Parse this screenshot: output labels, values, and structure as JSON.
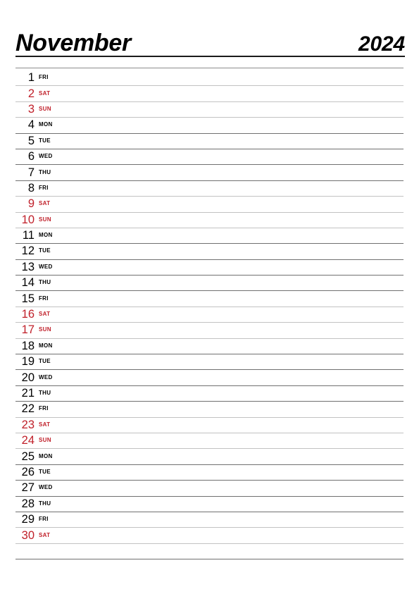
{
  "header": {
    "month": "November",
    "year": "2024"
  },
  "colors": {
    "weekend": "#c0202a",
    "weekday": "#000000",
    "rule_strong": "#1a1a1a",
    "rule_normal": "#707070",
    "rule_light": "#c2c2c2",
    "background": "#ffffff"
  },
  "days": [
    {
      "num": "1",
      "abbr": "FRI",
      "weekend": false
    },
    {
      "num": "2",
      "abbr": "SAT",
      "weekend": true
    },
    {
      "num": "3",
      "abbr": "SUN",
      "weekend": true
    },
    {
      "num": "4",
      "abbr": "MON",
      "weekend": false
    },
    {
      "num": "5",
      "abbr": "TUE",
      "weekend": false
    },
    {
      "num": "6",
      "abbr": "WED",
      "weekend": false
    },
    {
      "num": "7",
      "abbr": "THU",
      "weekend": false
    },
    {
      "num": "8",
      "abbr": "FRI",
      "weekend": false
    },
    {
      "num": "9",
      "abbr": "SAT",
      "weekend": true
    },
    {
      "num": "10",
      "abbr": "SUN",
      "weekend": true
    },
    {
      "num": "11",
      "abbr": "MON",
      "weekend": false
    },
    {
      "num": "12",
      "abbr": "TUE",
      "weekend": false
    },
    {
      "num": "13",
      "abbr": "WED",
      "weekend": false
    },
    {
      "num": "14",
      "abbr": "THU",
      "weekend": false
    },
    {
      "num": "15",
      "abbr": "FRI",
      "weekend": false
    },
    {
      "num": "16",
      "abbr": "SAT",
      "weekend": true
    },
    {
      "num": "17",
      "abbr": "SUN",
      "weekend": true
    },
    {
      "num": "18",
      "abbr": "MON",
      "weekend": false
    },
    {
      "num": "19",
      "abbr": "TUE",
      "weekend": false
    },
    {
      "num": "20",
      "abbr": "WED",
      "weekend": false
    },
    {
      "num": "21",
      "abbr": "THU",
      "weekend": false
    },
    {
      "num": "22",
      "abbr": "FRI",
      "weekend": false
    },
    {
      "num": "23",
      "abbr": "SAT",
      "weekend": true
    },
    {
      "num": "24",
      "abbr": "SUN",
      "weekend": true
    },
    {
      "num": "25",
      "abbr": "MON",
      "weekend": false
    },
    {
      "num": "26",
      "abbr": "TUE",
      "weekend": false
    },
    {
      "num": "27",
      "abbr": "WED",
      "weekend": false
    },
    {
      "num": "28",
      "abbr": "THU",
      "weekend": false
    },
    {
      "num": "29",
      "abbr": "FRI",
      "weekend": false
    },
    {
      "num": "30",
      "abbr": "SAT",
      "weekend": true
    }
  ]
}
